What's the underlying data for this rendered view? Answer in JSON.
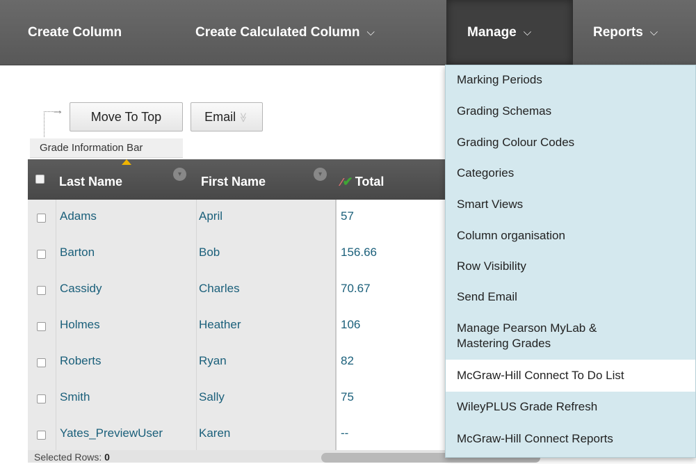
{
  "topbar": {
    "create_column": "Create Column",
    "create_calculated": "Create Calculated Column",
    "manage": "Manage",
    "reports": "Reports",
    "chevron": "⌵"
  },
  "toolbar": {
    "move_to_top": "Move To Top",
    "email": "Email",
    "dropdown_glyph": "≫"
  },
  "grade_info_bar": "Grade Information Bar",
  "grid": {
    "headers": {
      "last_name": "Last Name",
      "first_name": "First Name",
      "total": "Total"
    },
    "rows": [
      {
        "last": "Adams",
        "first": "April",
        "total": "57"
      },
      {
        "last": "Barton",
        "first": "Bob",
        "total": "156.66"
      },
      {
        "last": "Cassidy",
        "first": "Charles",
        "total": "70.67"
      },
      {
        "last": "Holmes",
        "first": "Heather",
        "total": "106"
      },
      {
        "last": "Roberts",
        "first": "Ryan",
        "total": "82"
      },
      {
        "last": "Smith",
        "first": "Sally",
        "total": "75"
      },
      {
        "last": "Yates_PreviewUser",
        "first": "Karen",
        "total": "--"
      }
    ]
  },
  "footer": {
    "label": "Selected Rows:",
    "count": "0"
  },
  "manage_menu": {
    "items": [
      "Marking Periods",
      "Grading Schemas",
      "Grading Colour Codes",
      "Categories",
      "Smart Views",
      "Column organisation",
      "Row Visibility",
      "Send Email",
      "Manage Pearson MyLab &",
      "Mastering Grades",
      "McGraw-Hill Connect To Do List",
      "WileyPLUS Grade Refresh",
      "McGraw-Hill Connect Reports"
    ]
  },
  "colors": {
    "topbar": "#5f5f5f",
    "menu_bg": "#d4e8ee",
    "link": "#1a5f7a",
    "sort_marker": "#f0b400",
    "check_green": "#3fa535",
    "slash_red": "#e07070"
  }
}
